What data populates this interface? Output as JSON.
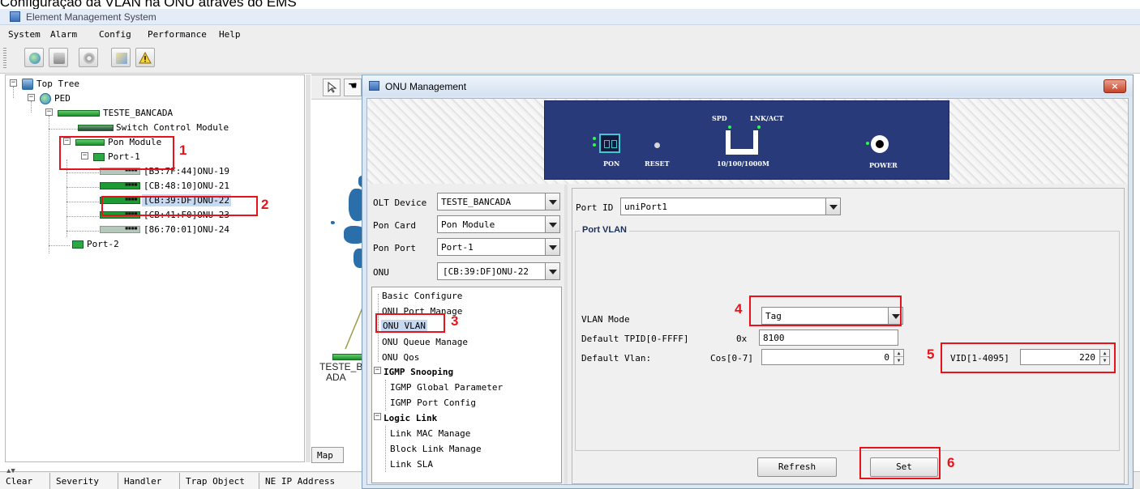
{
  "caption": "Configuração da VLAN na ONU através do EMS",
  "app": {
    "title": "Element Management System"
  },
  "menu": [
    "System",
    "Alarm",
    "Config",
    "Performance",
    "Help"
  ],
  "toolbar_icons": [
    "globe-icon",
    "database-icon",
    "gear-icon",
    "report-icon",
    "warning-icon"
  ],
  "tree": {
    "root": "Top Tree",
    "group": "PED",
    "device": "TESTE_BANCADA",
    "switch_module": "Switch Control Module",
    "pon_module": "Pon Module",
    "port1": "Port-1",
    "onus": [
      "[B5:7F:44]ONU-19",
      "[CB:48:10]ONU-21",
      "[CB:39:DF]ONU-22",
      "[CB:41:F0]ONU-23",
      "[86:70:01]ONU-24"
    ],
    "port2": "Port-2"
  },
  "map": {
    "tab": "Map",
    "node_label_1": "TESTE_B",
    "node_label_2": "ADA"
  },
  "statusbar": {
    "columns": [
      "Clear",
      "Severity",
      "Handler",
      "Trap Object",
      "NE IP Address"
    ]
  },
  "dialog": {
    "title": "ONU Management",
    "close": "×",
    "banner": {
      "pon": "PON",
      "reset": "RESET",
      "spd": "SPD",
      "lnk": "LNK/ACT",
      "speed": "10/100/1000M",
      "power": "POWER"
    },
    "selectors": [
      {
        "label": "OLT Device",
        "value": "TESTE_BANCADA"
      },
      {
        "label": "Pon Card",
        "value": "Pon Module"
      },
      {
        "label": "Pon Port",
        "value": "Port-1"
      },
      {
        "label": "ONU",
        "value": "[CB:39:DF]ONU-22"
      }
    ],
    "nav": {
      "basic": "Basic Configure",
      "port_manage": "ONU Port Manage",
      "vlan": "ONU VLAN",
      "queue": "ONU Queue Manage",
      "qos": "ONU Qos",
      "igmp": "IGMP Snooping",
      "igmp_global": "IGMP Global Parameter",
      "igmp_port": "IGMP Port Config",
      "logic": "Logic Link",
      "link_mac": "Link MAC Manage",
      "block_link": "Block Link Manage",
      "link_sla": "Link SLA"
    },
    "port_id": {
      "label": "Port ID",
      "value": "uniPort1"
    },
    "port_vlan": {
      "legend": "Port VLAN",
      "mode_label": "VLAN Mode",
      "mode_value": "Tag",
      "tpid_label": "Default TPID[0-FFFF]",
      "tpid_prefix": "0x",
      "tpid_value": "8100",
      "vlan_label": "Default Vlan:",
      "cos_label": "Cos[0-7]",
      "cos_value": "0",
      "vid_label": "VID[1-4095]",
      "vid_value": "220"
    },
    "buttons": {
      "refresh": "Refresh",
      "set": "Set"
    }
  },
  "annotations": [
    "1",
    "2",
    "3",
    "4",
    "5",
    "6"
  ],
  "colors": {
    "annotation": "#e8131a",
    "panel": "#283a7a",
    "led": "#22ff44",
    "selection": "#c6d9f0"
  }
}
